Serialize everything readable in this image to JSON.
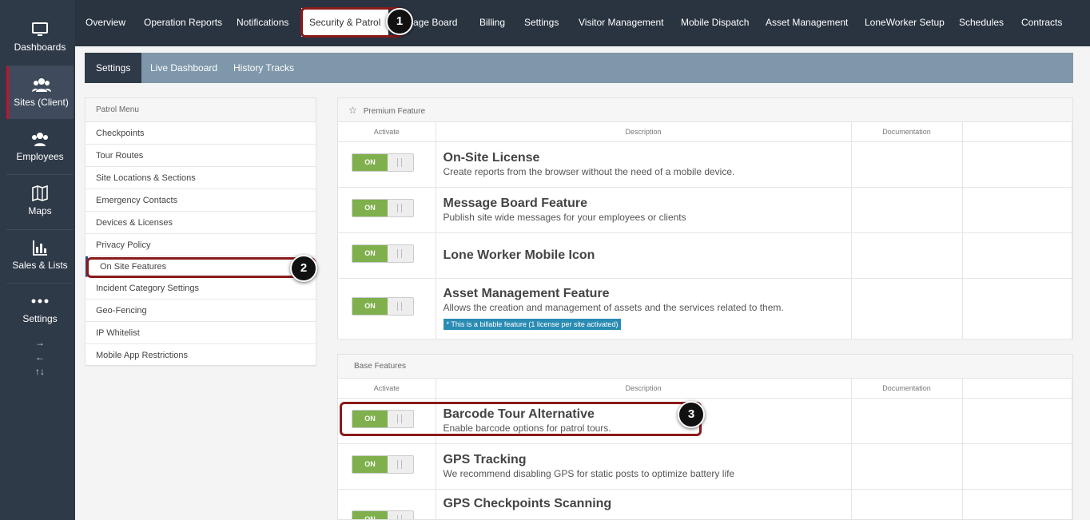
{
  "sidebar": {
    "items": [
      {
        "label": "Dashboards",
        "icon": "monitor-icon"
      },
      {
        "label": "Sites (Client)",
        "icon": "group-icon"
      },
      {
        "label": "Employees",
        "icon": "group-icon"
      },
      {
        "label": "Maps",
        "icon": "map-icon"
      },
      {
        "label": "Sales & Lists",
        "icon": "bar-chart-icon"
      },
      {
        "label": "Settings",
        "icon": "dots-icon"
      }
    ],
    "arrows": [
      "→",
      "←",
      "↑↓"
    ]
  },
  "topnav": {
    "tabs": [
      "Overview",
      "Operation Reports",
      "Notifications",
      "Security & Patrol",
      "sage Board",
      "Billing",
      "Settings",
      "Visitor Management",
      "Mobile Dispatch",
      "Asset Management",
      "LoneWorker Setup",
      "Schedules",
      "Contracts"
    ]
  },
  "subnav": {
    "tabs": [
      "Settings",
      "Live Dashboard",
      "History Tracks"
    ]
  },
  "patrol_menu": {
    "title": "Patrol Menu",
    "items": [
      "Checkpoints",
      "Tour Routes",
      "Site Locations & Sections",
      "Emergency Contacts",
      "Devices & Licenses",
      "Privacy Policy",
      "On Site Features",
      "Incident Category Settings",
      "Geo-Fencing",
      "IP Whitelist",
      "Mobile App Restrictions"
    ]
  },
  "premium": {
    "title": "Premium Feature",
    "icon": "star-icon",
    "columns": [
      "Activate",
      "Description",
      "Documentation"
    ],
    "rows": [
      {
        "toggle": "ON",
        "title": "On-Site License",
        "desc": "Create reports from the browser without the need of a mobile device."
      },
      {
        "toggle": "ON",
        "title": "Message Board Feature",
        "desc": "Publish site wide messages for your employees or clients"
      },
      {
        "toggle": "ON",
        "title": "Lone Worker Mobile Icon",
        "desc": ""
      },
      {
        "toggle": "ON",
        "title": "Asset Management Feature",
        "desc": "Allows the creation and management of assets and the services related to them.",
        "note": "* This is a billable feature (1 license per site activated)"
      }
    ]
  },
  "base": {
    "title": "Base Features",
    "columns": [
      "Activate",
      "Description",
      "Documentation"
    ],
    "rows": [
      {
        "toggle": "ON",
        "title": "Barcode Tour Alternative",
        "desc": "Enable barcode options for patrol tours."
      },
      {
        "toggle": "ON",
        "title": "GPS Tracking",
        "desc": "We recommend disabling GPS for static posts to optimize battery life"
      },
      {
        "toggle": "ON",
        "title": "GPS Checkpoints Scanning",
        "desc": ""
      }
    ]
  },
  "callouts": [
    "1",
    "2",
    "3"
  ],
  "colors": {
    "sidebar": "#2f3a48",
    "topnav": "#2a3441",
    "subnav": "#7e97aa",
    "toggle_on": "#7fb04d",
    "highlight": "#8b1a1a",
    "billable": "#2a8bb3"
  }
}
